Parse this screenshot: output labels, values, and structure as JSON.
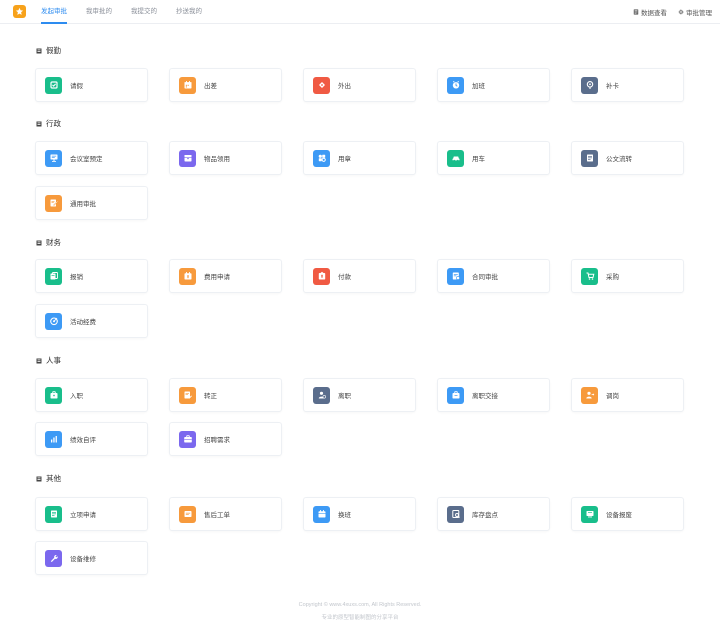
{
  "tabs": [
    {
      "label": "发起审批",
      "active": true
    },
    {
      "label": "我审批的",
      "active": false
    },
    {
      "label": "我提交的",
      "active": false
    },
    {
      "label": "抄送我的",
      "active": false
    }
  ],
  "top_links": [
    {
      "label": "数据查看",
      "icon": "document-icon"
    },
    {
      "label": "审批管理",
      "icon": "gear-icon"
    }
  ],
  "colors": {
    "primary": "#2d8cf0",
    "green": "#19be8b",
    "orange": "#f79a3c",
    "red": "#f05a43",
    "blue": "#3d9af5",
    "slate": "#5a6d8c",
    "purple": "#7b68ee",
    "logo": "#f7a21b"
  },
  "sections": [
    {
      "title": "假勤",
      "items": [
        {
          "label": "请假",
          "color": "#19be8b",
          "icon": "leave-icon"
        },
        {
          "label": "出差",
          "color": "#f79a3c",
          "icon": "calendar-icon"
        },
        {
          "label": "外出",
          "color": "#f05a43",
          "icon": "ticket-icon"
        },
        {
          "label": "加班",
          "color": "#3d9af5",
          "icon": "clock-icon"
        },
        {
          "label": "补卡",
          "color": "#5a6d8c",
          "icon": "location-icon"
        }
      ]
    },
    {
      "title": "行政",
      "items": [
        {
          "label": "会议室预定",
          "color": "#3d9af5",
          "icon": "meeting-room-icon"
        },
        {
          "label": "物品领用",
          "color": "#7b68ee",
          "icon": "box-icon"
        },
        {
          "label": "用章",
          "color": "#3d9af5",
          "icon": "stamp-icon"
        },
        {
          "label": "用车",
          "color": "#19be8b",
          "icon": "car-icon"
        },
        {
          "label": "公文流转",
          "color": "#5a6d8c",
          "icon": "file-icon"
        },
        {
          "label": "通用审批",
          "color": "#f79a3c",
          "icon": "edit-icon"
        }
      ]
    },
    {
      "title": "财务",
      "items": [
        {
          "label": "报销",
          "color": "#19be8b",
          "icon": "reimburse-icon"
        },
        {
          "label": "费用申请",
          "color": "#f79a3c",
          "icon": "wallet-icon"
        },
        {
          "label": "付款",
          "color": "#f05a43",
          "icon": "payment-icon"
        },
        {
          "label": "合同审批",
          "color": "#3d9af5",
          "icon": "contract-icon"
        },
        {
          "label": "采购",
          "color": "#19be8b",
          "icon": "cart-icon"
        },
        {
          "label": "活动经费",
          "color": "#3d9af5",
          "icon": "target-icon"
        }
      ]
    },
    {
      "title": "人事",
      "items": [
        {
          "label": "入职",
          "color": "#19be8b",
          "icon": "onboard-icon"
        },
        {
          "label": "转正",
          "color": "#f79a3c",
          "icon": "regularize-icon"
        },
        {
          "label": "离职",
          "color": "#5a6d8c",
          "icon": "resign-icon"
        },
        {
          "label": "离职交接",
          "color": "#3d9af5",
          "icon": "handover-icon"
        },
        {
          "label": "调岗",
          "color": "#f79a3c",
          "icon": "transfer-icon"
        },
        {
          "label": "绩效自评",
          "color": "#3d9af5",
          "icon": "chart-icon"
        },
        {
          "label": "招聘需求",
          "color": "#7b68ee",
          "icon": "briefcase-icon"
        }
      ]
    },
    {
      "title": "其他",
      "items": [
        {
          "label": "立项申请",
          "color": "#19be8b",
          "icon": "project-icon"
        },
        {
          "label": "售后工单",
          "color": "#f79a3c",
          "icon": "ticket-list-icon"
        },
        {
          "label": "换班",
          "color": "#3d9af5",
          "icon": "shift-icon"
        },
        {
          "label": "库存盘点",
          "color": "#5a6d8c",
          "icon": "inventory-icon"
        },
        {
          "label": "设备报废",
          "color": "#19be8b",
          "icon": "device-icon"
        },
        {
          "label": "设备维修",
          "color": "#7b68ee",
          "icon": "wrench-icon"
        }
      ]
    }
  ],
  "footer": {
    "copyright": "Copyright © www.4xuxs.com, All Rights Reserved.",
    "tagline": "专业的原型智能制图的分享平台"
  }
}
